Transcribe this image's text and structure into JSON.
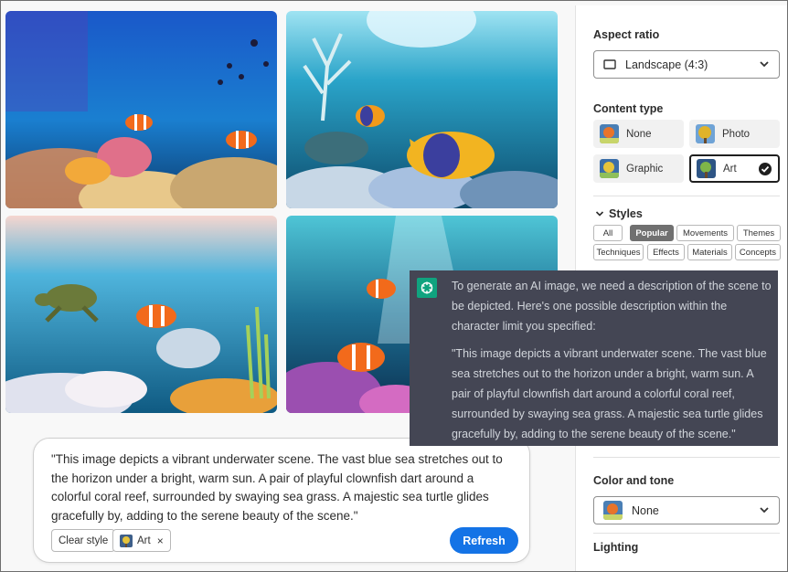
{
  "prompt": {
    "text": "\"This image depicts a vibrant underwater scene. The vast blue sea stretches out to the horizon under a bright, warm sun. A pair of playful clownfish dart around a colorful coral reef, surrounded by swaying sea grass. A majestic sea turtle glides gracefully by, adding to the serene beauty of the scene.\"",
    "clear_style_label": "Clear style",
    "style_chip_label": "Art",
    "style_chip_remove": "×",
    "refresh_label": "Refresh"
  },
  "panel": {
    "aspect_ratio": {
      "label": "Aspect ratio",
      "value": "Landscape (4:3)"
    },
    "content_type": {
      "label": "Content type",
      "options": [
        {
          "label": "None",
          "icon": "image-thumb-icon",
          "selected": false
        },
        {
          "label": "Photo",
          "icon": "image-thumb-icon",
          "selected": false
        },
        {
          "label": "Graphic",
          "icon": "image-thumb-icon",
          "selected": false
        },
        {
          "label": "Art",
          "icon": "image-thumb-icon",
          "selected": true
        }
      ]
    },
    "styles": {
      "label": "Styles",
      "tabs": [
        "All",
        "Popular",
        "Movements",
        "Themes",
        "Techniques",
        "Effects",
        "Materials",
        "Concepts"
      ],
      "active_tab": "Popular"
    },
    "color_and_tone": {
      "label": "Color and tone",
      "value": "None"
    },
    "lighting": {
      "label": "Lighting"
    }
  },
  "chat": {
    "intro": "To generate an AI image, we need a description of the scene to be depicted. Here's one possible description within the character limit you specified:",
    "quote": "\"This image depicts a vibrant underwater scene. The vast blue sea stretches out to the horizon under a bright, warm sun. A pair of playful clownfish dart around a colorful coral reef, surrounded by swaying sea grass. A majestic sea turtle glides gracefully by, adding to the serene beauty of the scene.\""
  },
  "colors": {
    "accent": "#1473e6",
    "chat_bg": "#444654",
    "chat_logo": "#10a37f",
    "active_tab": "#707070"
  }
}
